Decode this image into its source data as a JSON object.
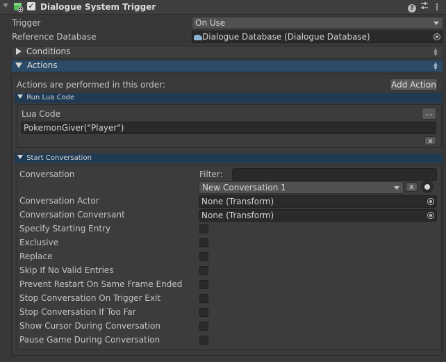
{
  "header": {
    "title": "Dialogue System Trigger",
    "enabled": true,
    "icons": [
      "foldout-arrow-icon",
      "component-icon",
      "help-icon",
      "preset-icon",
      "menu-icon"
    ]
  },
  "trigger": {
    "label": "Trigger",
    "value": "On Use"
  },
  "reference_database": {
    "label": "Reference Database",
    "value": "Dialogue Database (Dialogue Database)"
  },
  "conditions": {
    "label": "Conditions"
  },
  "actions": {
    "label": "Actions",
    "order_text": "Actions are performed in this order:",
    "add_action_label": "Add Action",
    "run_lua": {
      "title": "Run Lua Code",
      "lua_label": "Lua Code",
      "ellipsis_label": "...",
      "code": "PokemonGiver(\"Player\")",
      "remove_label": "x"
    },
    "start_conversation": {
      "title": "Start Conversation",
      "conversation_label": "Conversation",
      "filter_label": "Filter:",
      "filter_value": "",
      "conversation_value": "New Conversation 1",
      "clear_label": "x",
      "actor_label": "Conversation Actor",
      "actor_value": "None (Transform)",
      "conversant_label": "Conversation Conversant",
      "conversant_value": "None (Transform)",
      "toggles": [
        {
          "label": "Specify Starting Entry",
          "checked": false
        },
        {
          "label": "Exclusive",
          "checked": false
        },
        {
          "label": "Replace",
          "checked": false
        },
        {
          "label": "Skip If No Valid Entries",
          "checked": false
        },
        {
          "label": "Prevent Restart On Same Frame Ended",
          "checked": false
        },
        {
          "label": "Stop Conversation On Trigger Exit",
          "checked": false
        },
        {
          "label": "Stop Conversation If Too Far",
          "checked": false
        },
        {
          "label": "Show Cursor During Conversation",
          "checked": false
        },
        {
          "label": "Pause Game During Conversation",
          "checked": false
        }
      ]
    }
  },
  "colors": {
    "background": "#383838",
    "field": "#2a2a2a",
    "actions_bar": "#2c4a66",
    "section_bar": "#1f3a52",
    "component_icon": "#4fb54f"
  }
}
